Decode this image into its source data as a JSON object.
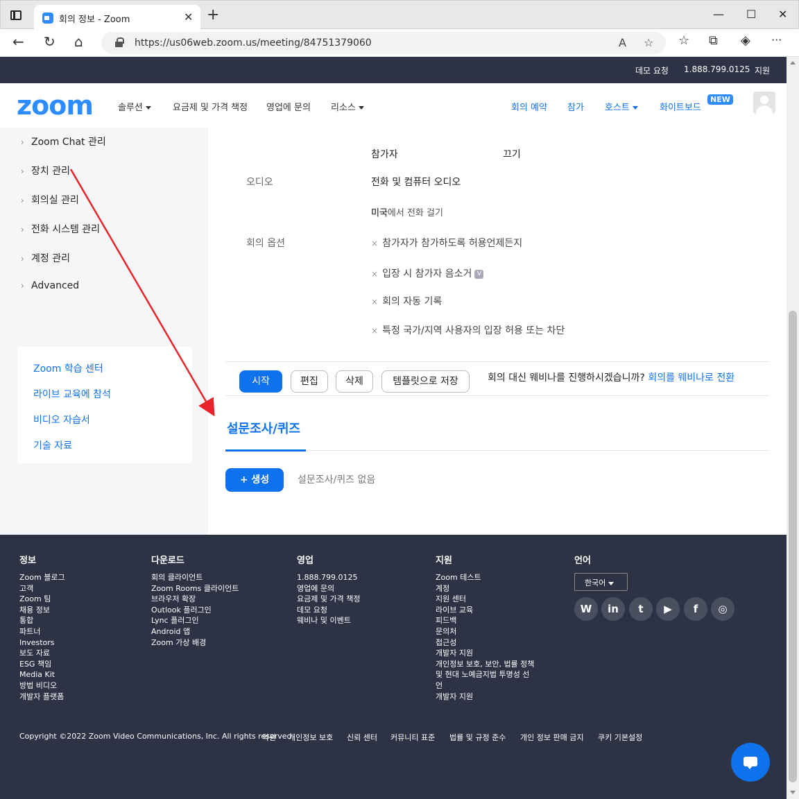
{
  "browser": {
    "tab_title": "회의 정보 - Zoom",
    "tab_close": "✕",
    "new_tab": "+",
    "url": "https://us06web.zoom.us/meeting/84751379060",
    "window_minimize": "—",
    "window_maximize": "☐",
    "window_close": "✕",
    "back": "←",
    "refresh": "↻",
    "home": "⌂",
    "read_aloud": "A",
    "favorite": "☆",
    "favorites_list": "☆",
    "collections": "⧉",
    "extension": "◈",
    "more": "···"
  },
  "topstrip": {
    "demo": "데모 요청",
    "phone": "1.888.799.0125",
    "support": "지원"
  },
  "header": {
    "logo": "zoom",
    "nav": [
      {
        "label": "솔루션",
        "caret": true
      },
      {
        "label": "요금제 및 가격 책정"
      },
      {
        "label": "영업에 문의"
      },
      {
        "label": "리소스",
        "caret": true
      }
    ],
    "right_nav": [
      {
        "label": "회의 예약"
      },
      {
        "label": "참가"
      },
      {
        "label": "호스트",
        "caret": true
      },
      {
        "label": "화이트보드"
      }
    ],
    "new_badge": "NEW"
  },
  "sidebar": {
    "items": [
      {
        "label": "Zoom Chat 관리"
      },
      {
        "label": "장치 관리"
      },
      {
        "label": "회의실 관리"
      },
      {
        "label": "전화 시스템 관리"
      },
      {
        "label": "계정 관리"
      },
      {
        "label": "Advanced"
      }
    ],
    "learn_links": [
      {
        "label": "Zoom 학습 센터"
      },
      {
        "label": "라이브 교육에 참석"
      },
      {
        "label": "비디오 자습서"
      },
      {
        "label": "기술 자료"
      }
    ],
    "chevron": "›"
  },
  "meeting": {
    "video_participant_label": "참가자",
    "video_participant_value": "끄기",
    "audio_label": "오디오",
    "audio_value": "전화 및 컴퓨터 오디오",
    "dialin_bold": "미국",
    "dialin_rest": "에서 전화 걸기",
    "options_label": "회의 옵션",
    "options": [
      {
        "label": "참가자가 참가하도록 허용언제든지"
      },
      {
        "label": "입장 시 참가자 음소거",
        "badge": "V"
      },
      {
        "label": "회의 자동 기록"
      },
      {
        "label": "특정 국가/지역 사용자의 입장 허용 또는 차단"
      }
    ],
    "option_mark": "×"
  },
  "actions": {
    "start": "시작",
    "edit": "편집",
    "delete": "삭제",
    "save_template": "템플릿으로 저장",
    "webinar_question": "회의 대신 웨비나를 진행하시겠습니까? ",
    "webinar_link": "회의를 웨비나로 전환"
  },
  "poll": {
    "title": "설문조사/퀴즈",
    "create": "+ 생성",
    "empty": "설문조사/퀴즈 없음"
  },
  "footer": {
    "columns": [
      {
        "title": "정보",
        "items": [
          "Zoom 블로그",
          "고객",
          "Zoom 팀",
          "채용 정보",
          "통합",
          "파트너",
          "Investors",
          "보도 자료",
          "ESG 책임",
          "Media Kit",
          "방법 비디오",
          "개발자 플랫폼"
        ]
      },
      {
        "title": "다운로드",
        "items": [
          "회의 클라이언트",
          "Zoom Rooms 클라이언트",
          "브라우저 확장",
          "Outlook 플러그인",
          "Lync 플러그인",
          "Android 앱",
          "Zoom 가상 배경"
        ]
      },
      {
        "title": "영업",
        "items": [
          "1.888.799.0125",
          "영업에 문의",
          "요금제 및 가격 책정",
          "데모 요청",
          "웨비나 및 이벤트"
        ]
      },
      {
        "title": "지원",
        "items": [
          "Zoom 테스트",
          "계정",
          "지원 센터",
          "라이브 교육",
          "피드백",
          "문의처",
          "접근성",
          "개발자 지원",
          "개인정보 보호, 보안, 법률 정책",
          "및 현대 노예금지법 투명성 선",
          "언",
          "개발자 지원"
        ]
      }
    ],
    "language_title": "언어",
    "language_value": "한국어",
    "social": [
      {
        "icon": "wordpress-icon",
        "glyph": "W"
      },
      {
        "icon": "linkedin-icon",
        "glyph": "in"
      },
      {
        "icon": "twitter-icon",
        "glyph": "t"
      },
      {
        "icon": "youtube-icon",
        "glyph": "▶"
      },
      {
        "icon": "facebook-icon",
        "glyph": "f"
      },
      {
        "icon": "instagram-icon",
        "glyph": "◎"
      }
    ],
    "copyright": "Copyright ©2022 Zoom Video Communications, Inc. All rights reserved.",
    "legal": [
      "약관",
      "개인정보 보호",
      "신뢰 센터",
      "커뮤니티 표준",
      "법률 및 규정 준수",
      "개인 정보 판매 금지",
      "쿠키 기본설정"
    ]
  },
  "colors": {
    "brand_blue": "#0e72ed",
    "logo_blue": "#2d8cff",
    "dark_navy": "#2e3245",
    "annotation_red": "#e8242a"
  }
}
